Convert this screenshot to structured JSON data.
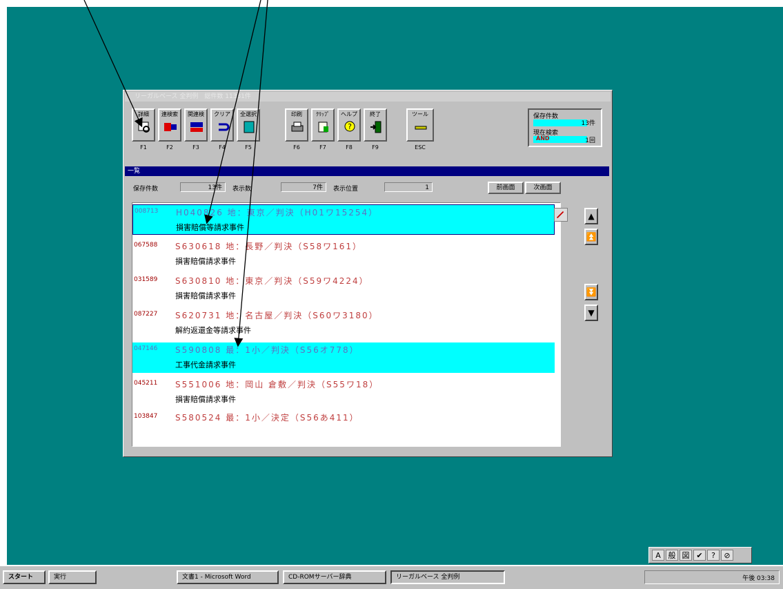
{
  "window": {
    "title": "リーガルベース 全判例　総件数 11331件"
  },
  "toolbar": {
    "buttons": [
      {
        "label": "詳細",
        "fkey": "F1",
        "icon": "magnifier-document-icon"
      },
      {
        "label": "連検索",
        "fkey": "F2",
        "icon": "and-or-icon"
      },
      {
        "label": "関連検",
        "fkey": "F3",
        "icon": "connect-icon"
      },
      {
        "label": "クリア",
        "fkey": "F4",
        "icon": "undo-arrow-icon"
      },
      {
        "label": "全選択",
        "fkey": "F5",
        "icon": "book-icon"
      },
      {
        "label": "印刷",
        "fkey": "F6",
        "icon": "printer-icon"
      },
      {
        "label": "ｸﾘｯﾌﾟ",
        "fkey": "F7",
        "icon": "clip-icon"
      },
      {
        "label": "ヘルプ",
        "fkey": "F8",
        "icon": "question-icon"
      },
      {
        "label": "終了",
        "fkey": "F9",
        "icon": "exit-door-icon"
      },
      {
        "label": "ツール",
        "fkey": "ESC",
        "icon": "tool-icon"
      }
    ],
    "status": {
      "saved_label": "保存件数",
      "saved_count": "13件",
      "search_label": "現在検索",
      "mode": "AND",
      "search_count": "1回"
    }
  },
  "list_header": "一覧",
  "infobar": {
    "saved_caption": "保存件数",
    "saved_value": "13件",
    "display_caption": "表示数",
    "display_value": "7件",
    "position_caption": "表示位置",
    "position_value": "1",
    "prev_button": "前画面",
    "next_button": "次画面"
  },
  "rows": [
    {
      "id": "008713",
      "case": "H040826 地：東京／判決（H01ワ15254）",
      "title": "損害賠償等請求事件",
      "selected": true
    },
    {
      "id": "067588",
      "case": "S630618 地：長野／判決（S58ワ161）",
      "title": "損害賠償請求事件",
      "selected": false
    },
    {
      "id": "031589",
      "case": "S630810 地：東京／判決（S59ワ4224）",
      "title": "損害賠償請求事件",
      "selected": false
    },
    {
      "id": "087227",
      "case": "S620731 地：名古屋／判決（S60ワ3180）",
      "title": "解約返還金等請求事件",
      "selected": false
    },
    {
      "id": "047146",
      "case": "S590808 最：1小／判決（S56オ778）",
      "title": "工事代金請求事件",
      "selected": true
    },
    {
      "id": "045211",
      "case": "S551006 地：岡山 倉敷／判決（S55ワ18）",
      "title": "損害賠償請求事件",
      "selected": false
    },
    {
      "id": "103847",
      "case": "S580524 最：1小／決定（S56あ411）",
      "title": "",
      "selected": false
    }
  ],
  "side_buttons": [
    "▲",
    "⏫",
    "⏬",
    "▼"
  ],
  "taskbar": {
    "start": "スタート",
    "quick": "実行",
    "tasks": [
      "文書1 - Microsoft Word",
      "CD-ROMサーバー辞典",
      "リーガルベース 全判例"
    ],
    "clock": "午後 03:38"
  },
  "langbar": [
    "A",
    "般",
    "図",
    "✔",
    "?",
    "⊘"
  ]
}
